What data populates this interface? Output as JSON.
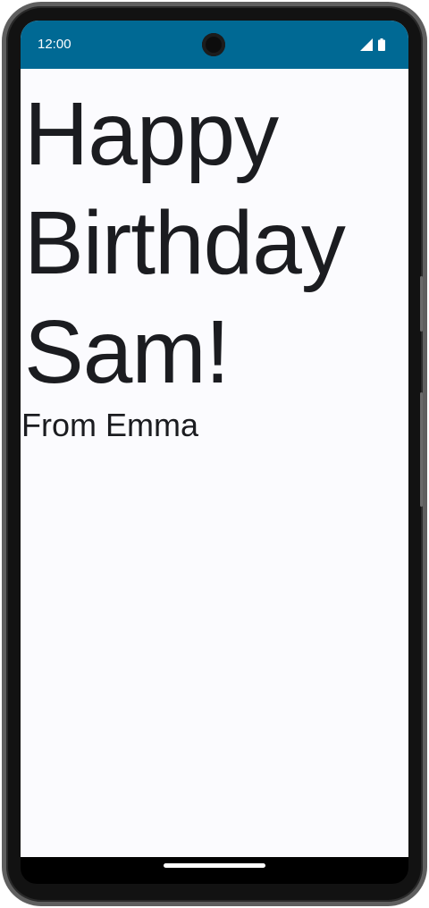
{
  "status_bar": {
    "time": "12:00",
    "background_color": "#006994",
    "icons": [
      "signal-icon",
      "battery-icon"
    ]
  },
  "greeting": {
    "lines": [
      "Happy",
      "Birthday",
      "Sam!"
    ]
  },
  "signature": {
    "text": "From Emma"
  },
  "colors": {
    "text": "#1b1c20",
    "screen_background": "#fbfbfe"
  }
}
